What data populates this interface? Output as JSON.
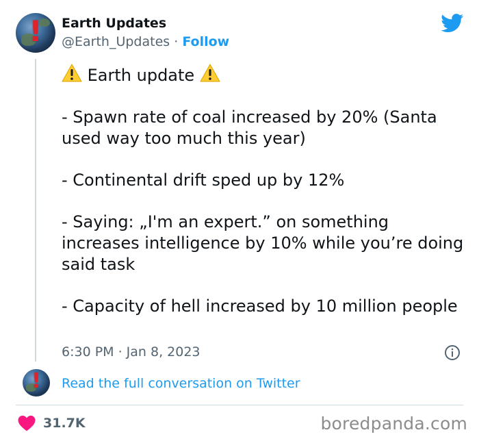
{
  "header": {
    "name": "Earth Updates",
    "handle": "@Earth_Updates",
    "separator": "·",
    "follow_label": "Follow"
  },
  "tweet": {
    "title": "Earth update",
    "paragraphs": [
      "- Spawn rate of coal increased by 20% (Santa used way too much this year)",
      "- Continental drift sped up by 12%",
      "- Saying: „I'm an expert.” on something increases intelligence by 10% while you’re doing said task",
      "- Capacity of hell increased by 10 million people"
    ],
    "timestamp": "6:30 PM · Jan 8, 2023"
  },
  "read_link": "Read the full conversation on Twitter",
  "likes": "31.7K",
  "watermark": "boredpanda.com",
  "icons": {
    "avatar": "earth-globe-with-red-exclamation",
    "logo": "twitter-bird-icon",
    "warning": "warning-icon",
    "info": "info-icon",
    "heart": "heart-icon"
  },
  "colors": {
    "accent": "#1d9bf0",
    "heart": "#f91880",
    "secondary_text": "#536471",
    "warning": "#ffcc32"
  }
}
